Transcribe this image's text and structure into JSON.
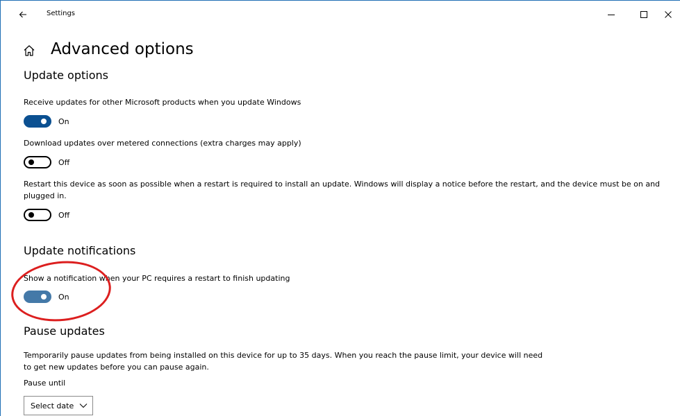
{
  "window": {
    "app_title": "Settings",
    "controls": [
      "minimize",
      "maximize",
      "close"
    ]
  },
  "page": {
    "title": "Advanced options"
  },
  "update_options": {
    "heading": "Update options",
    "items": [
      {
        "label": "Receive updates for other Microsoft products when you update Windows",
        "state": "On"
      },
      {
        "label": "Download updates over metered connections (extra charges may apply)",
        "state": "Off"
      },
      {
        "label": "Restart this device as soon as possible when a restart is required to install an update. Windows will display a notice before the restart, and the device must be on and plugged in.",
        "state": "Off"
      }
    ]
  },
  "update_notifications": {
    "heading": "Update notifications",
    "items": [
      {
        "label": "Show a notification when your PC requires a restart to finish updating",
        "state": "On"
      }
    ]
  },
  "pause_updates": {
    "heading": "Pause updates",
    "description": "Temporarily pause updates from being installed on this device for up to 35 days. When you reach the pause limit, your device will need to get new updates before you can pause again.",
    "pause_until_label": "Pause until",
    "select_value": "Select date"
  },
  "colors": {
    "toggle_on": "#0b5091",
    "annotation_circle": "#dc1f1f",
    "window_border": "#1f6fb5"
  },
  "icons": {
    "back": "back-arrow-icon",
    "home": "home-icon",
    "minimize": "minimize-icon",
    "maximize": "maximize-icon",
    "close": "close-icon",
    "dropdown": "chevron-down-icon"
  }
}
